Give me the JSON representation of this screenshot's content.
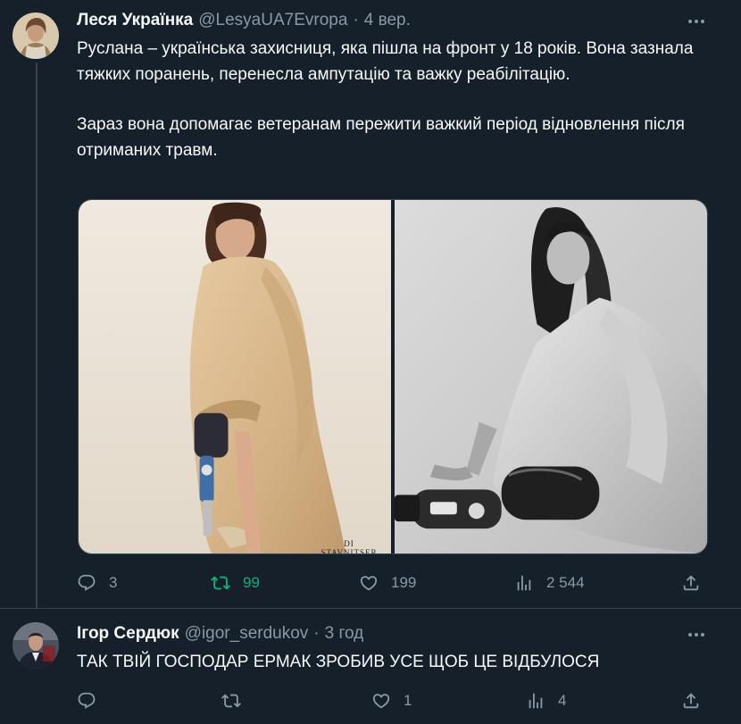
{
  "tweet": {
    "display_name": "Леся Українка",
    "handle": "@LesyaUA7Evropa",
    "separator": "·",
    "time": "4 вер.",
    "paragraphs": [
      "Руслана – українська захисниця, яка пішла на фронт у 18 років. Вона зазнала тяжких поранень, перенесла ампутацію та важку реабілітацію.",
      "Зараз вона допомагає ветеранам пережити важкий період відновлення після отриманих травм."
    ],
    "photo_watermark": "DI STAVNITSER",
    "stats": {
      "replies": "3",
      "retweets": "99",
      "likes": "199",
      "views": "2 544"
    },
    "retweeted": true,
    "accent_retweet": "#00ba7c"
  },
  "reply": {
    "display_name": "Ігор Сердюк",
    "handle": "@igor_serdukov",
    "separator": "·",
    "time": "3 год",
    "text": "ТАК ТВІЙ ГОСПОДАР ЕРМАК ЗРОБИВ УСЕ ЩОБ ЦЕ ВІДБУЛОСЯ",
    "stats": {
      "replies": "",
      "retweets": "",
      "likes": "1",
      "views": "4"
    }
  },
  "theme": {
    "background": "#15202b",
    "text": "#f7f9f9",
    "secondary": "#8b98a5",
    "border": "#38444d"
  },
  "icons": [
    "more-icon",
    "reply-icon",
    "retweet-icon",
    "like-icon",
    "views-icon",
    "share-icon"
  ]
}
